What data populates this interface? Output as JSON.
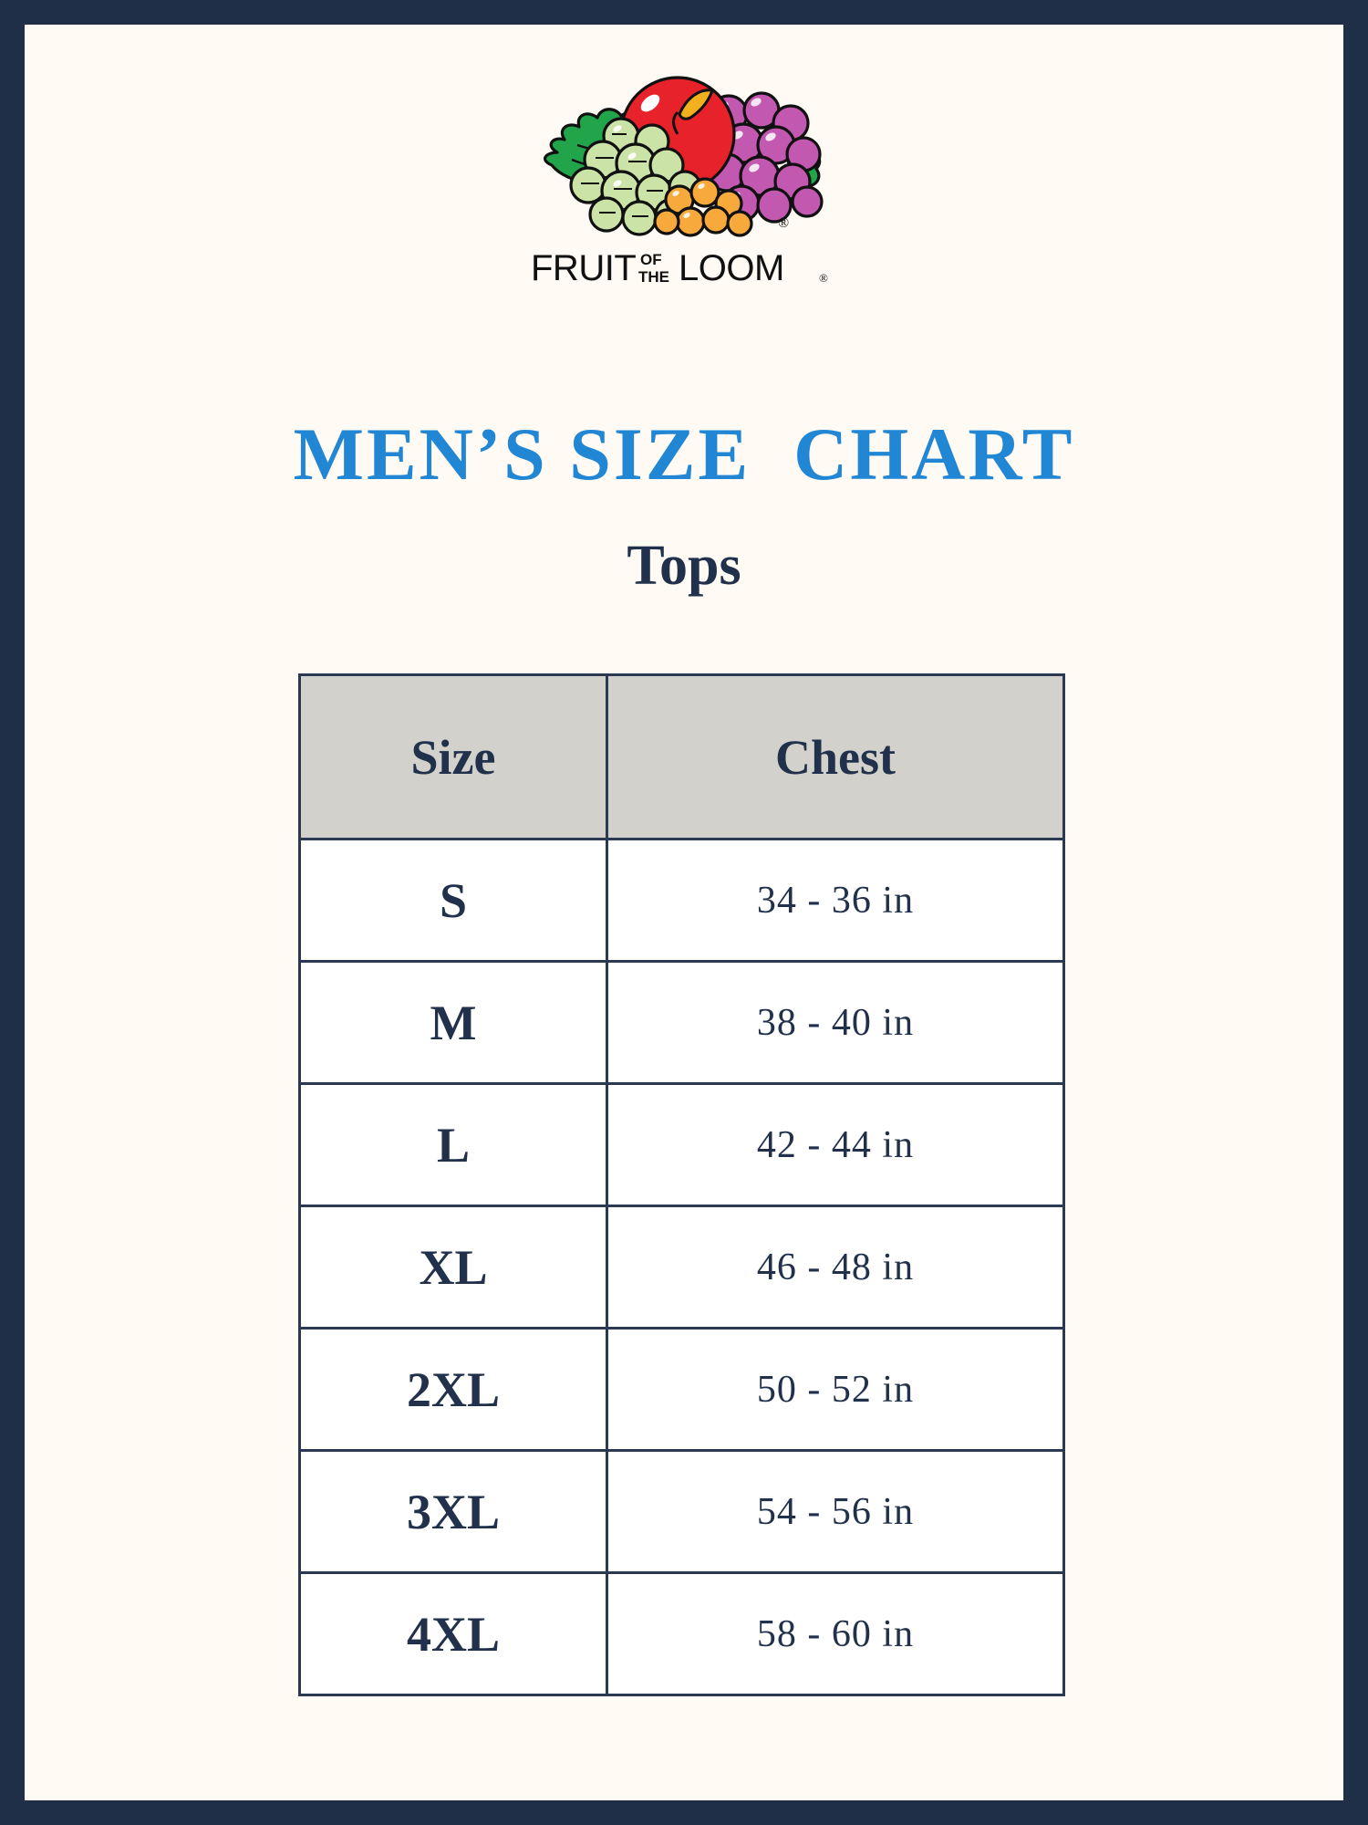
{
  "brand": {
    "logo_icon": "fruit-cluster-icon",
    "wordmark_line1": "FRUIT",
    "wordmark_of": "OF",
    "wordmark_the": "THE",
    "wordmark_line2": "LOOM",
    "wordmark_registered": "®",
    "colors": {
      "apple_red": "#E8222A",
      "leaf_green": "#22A44A",
      "green_grape": "#CCE3A8",
      "purple_grape": "#C258B0",
      "orange_berry": "#F7A93B",
      "outline": "#111111"
    }
  },
  "header": {
    "title": "MEN’S SIZE  CHART",
    "subtitle": "Tops"
  },
  "theme": {
    "frame_navy": "#1F2F47",
    "paper_cream": "#FFFBF4",
    "title_blue": "#2186D4",
    "text_navy": "#21314B",
    "header_row_gray": "#D2D1CC",
    "grid_line": "#2B3A52"
  },
  "chart_data": {
    "type": "table",
    "title": "MEN’S SIZE  CHART",
    "subtitle": "Tops",
    "columns": [
      "Size",
      "Chest"
    ],
    "rows": [
      {
        "size": "S",
        "chest": "34 - 36 in"
      },
      {
        "size": "M",
        "chest": "38 - 40 in"
      },
      {
        "size": "L",
        "chest": "42 - 44 in"
      },
      {
        "size": "XL",
        "chest": "46 - 48 in"
      },
      {
        "size": "2XL",
        "chest": "50 - 52 in"
      },
      {
        "size": "3XL",
        "chest": "54 - 56 in"
      },
      {
        "size": "4XL",
        "chest": "58 - 60 in"
      }
    ]
  }
}
